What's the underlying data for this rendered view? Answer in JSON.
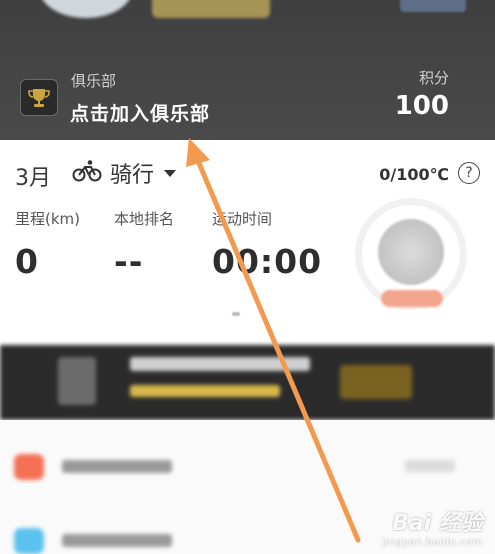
{
  "header": {
    "club_label": "俱乐部",
    "club_action": "点击加入俱乐部",
    "points_label": "积分",
    "points_value": "100"
  },
  "stats": {
    "month": "3月",
    "sport": "骑行",
    "sport_icon": "bicycle-icon",
    "capacity": "0/100℃",
    "help_icon": "question-circle-icon",
    "metrics": [
      {
        "label": "里程(km)",
        "value": "0"
      },
      {
        "label": "本地排名",
        "value": "--"
      },
      {
        "label": "运动时间",
        "value": "00:00"
      }
    ]
  },
  "watermark": {
    "logo": "Bai 经验",
    "url": "jingyan.baidu.com"
  },
  "colors": {
    "header_bg": "#444444",
    "arrow": "#f39a4e"
  }
}
